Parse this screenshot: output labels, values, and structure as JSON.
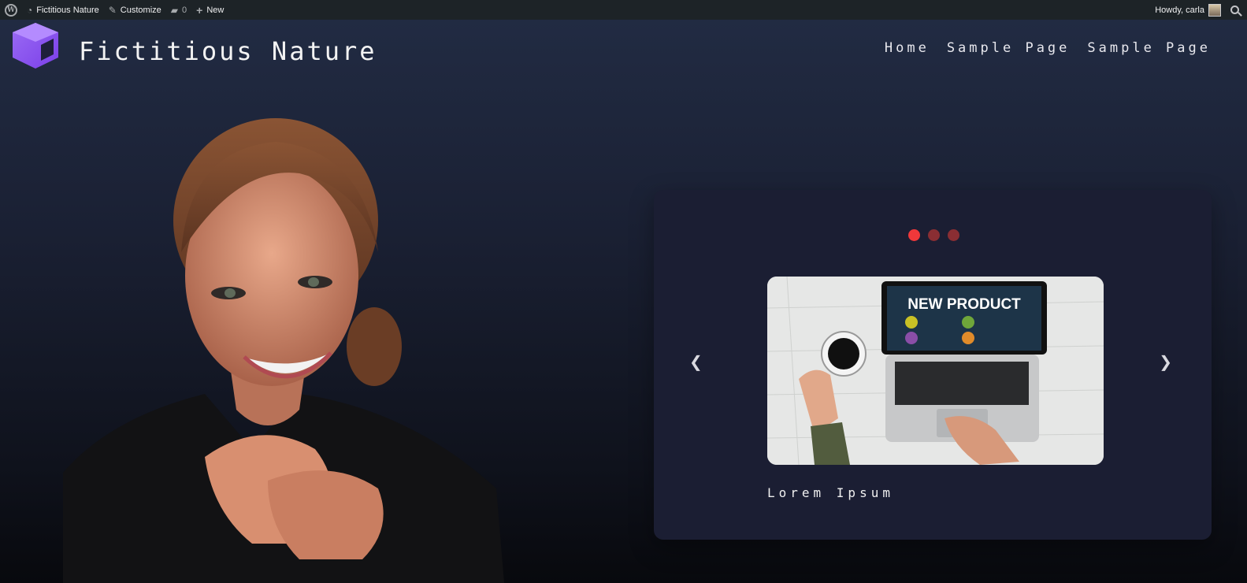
{
  "adminbar": {
    "site_name": "Fictitious Nature",
    "customize": "Customize",
    "comments_count": "0",
    "new": "New",
    "howdy": "Howdy, carla"
  },
  "header": {
    "site_title": "Fictitious Nature",
    "nav": [
      "Home",
      "Sample Page",
      "Sample Page"
    ]
  },
  "slider": {
    "dots": 3,
    "active_dot": 0,
    "slide_headline": "NEW PRODUCT",
    "caption": "Lorem Ipsum",
    "accent": "#f0383a"
  },
  "colors": {
    "adminbar_bg": "#1d2327",
    "card_bg": "#1b1e33",
    "logo_gradient": [
      "#a45cf0",
      "#6b4bff"
    ]
  }
}
